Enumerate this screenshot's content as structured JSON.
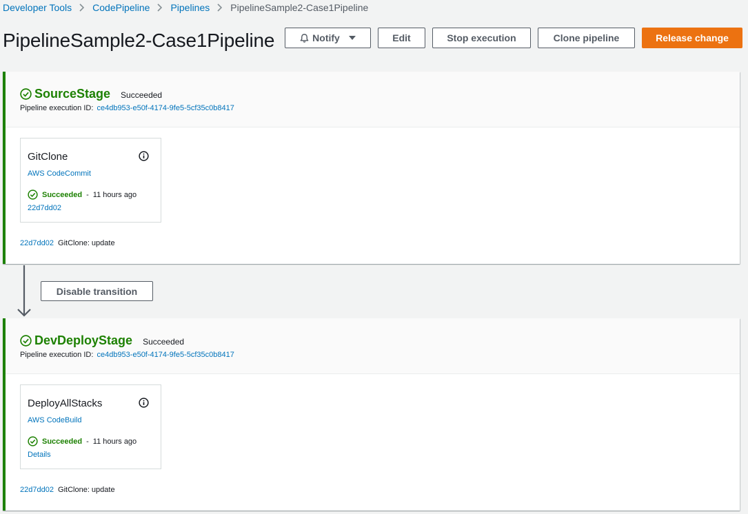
{
  "breadcrumb": {
    "items": [
      "Developer Tools",
      "CodePipeline",
      "Pipelines"
    ],
    "current": "PipelineSample2-Case1Pipeline"
  },
  "page": {
    "title": "PipelineSample2-Case1Pipeline"
  },
  "toolbar": {
    "notify_label": "Notify",
    "edit_label": "Edit",
    "stop_label": "Stop execution",
    "clone_label": "Clone pipeline",
    "release_label": "Release change"
  },
  "colors": {
    "success": "#1d8102",
    "link": "#0073bb",
    "primary": "#ec7211"
  },
  "stages": [
    {
      "name": "SourceStage",
      "status": "Succeeded",
      "exec_label": "Pipeline execution ID:",
      "exec_id": "ce4db953-e50f-4174-9fe5-5cf35c0b8417",
      "action": {
        "name": "GitClone",
        "provider": "AWS CodeCommit",
        "status": "Succeeded",
        "separator": "-",
        "time": "11 hours ago",
        "link": "22d7dd02",
        "icon": "info-icon"
      },
      "footer_commit": "22d7dd02",
      "footer_message": "GitClone: update"
    },
    {
      "name": "DevDeployStage",
      "status": "Succeeded",
      "exec_label": "Pipeline execution ID:",
      "exec_id": "ce4db953-e50f-4174-9fe5-5cf35c0b8417",
      "action": {
        "name": "DeployAllStacks",
        "provider": "AWS CodeBuild",
        "status": "Succeeded",
        "separator": "-",
        "time": "11 hours ago",
        "link": "Details",
        "icon": "info-icon"
      },
      "footer_commit": "22d7dd02",
      "footer_message": "GitClone: update"
    }
  ],
  "transition": {
    "button_label": "Disable transition"
  }
}
